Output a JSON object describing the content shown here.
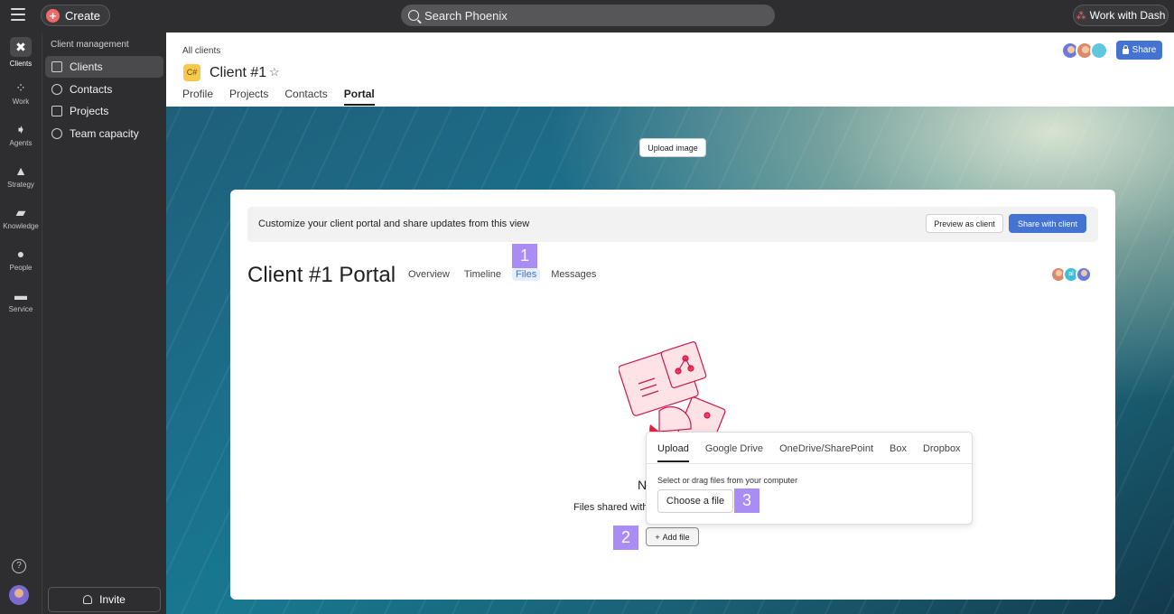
{
  "topbar": {
    "create_label": "Create",
    "search_placeholder": "Search Phoenix",
    "work_with_dash_label": "Work with Dash"
  },
  "rail": {
    "items": [
      {
        "label": "Clients",
        "icon": "clients-icon",
        "active": true
      },
      {
        "label": "Work",
        "icon": "work-icon"
      },
      {
        "label": "Agents",
        "icon": "agents-icon"
      },
      {
        "label": "Strategy",
        "icon": "strategy-icon"
      },
      {
        "label": "Knowledge",
        "icon": "knowledge-icon"
      },
      {
        "label": "People",
        "icon": "people-icon"
      },
      {
        "label": "Service",
        "icon": "service-icon"
      }
    ]
  },
  "sidepanel": {
    "title": "Client management",
    "items": [
      {
        "label": "Clients",
        "active": true
      },
      {
        "label": "Contacts"
      },
      {
        "label": "Projects"
      },
      {
        "label": "Team capacity"
      }
    ],
    "invite_label": "Invite"
  },
  "header": {
    "breadcrumb": "All clients",
    "badge": "C#",
    "title": "Client #1",
    "tabs": [
      "Profile",
      "Projects",
      "Contacts",
      "Portal"
    ],
    "active_tab": "Portal",
    "share_label": "Share"
  },
  "banner": {
    "upload_image_label": "Upload image"
  },
  "portal": {
    "customize_text": "Customize your client portal and share updates from this view",
    "preview_label": "Preview as client",
    "share_client_label": "Share with client",
    "title": "Client #1 Portal",
    "tabs": [
      "Overview",
      "Timeline",
      "Files",
      "Messages"
    ],
    "active_tab": "Files",
    "avatar_initials": "al",
    "empty_title": "N",
    "empty_desc": "Files shared with",
    "add_file_label": "Add file"
  },
  "popover": {
    "tabs": [
      "Upload",
      "Google Drive",
      "OneDrive/SharePoint",
      "Box",
      "Dropbox"
    ],
    "active_tab": "Upload",
    "hint": "Select or drag files from your computer",
    "choose_label": "Choose a file"
  },
  "markers": [
    "1",
    "2",
    "3"
  ],
  "colors": {
    "accent": "#4573d2",
    "marker": "#a98cf4",
    "create": "#f06a6a",
    "badge": "#f8c84a"
  }
}
